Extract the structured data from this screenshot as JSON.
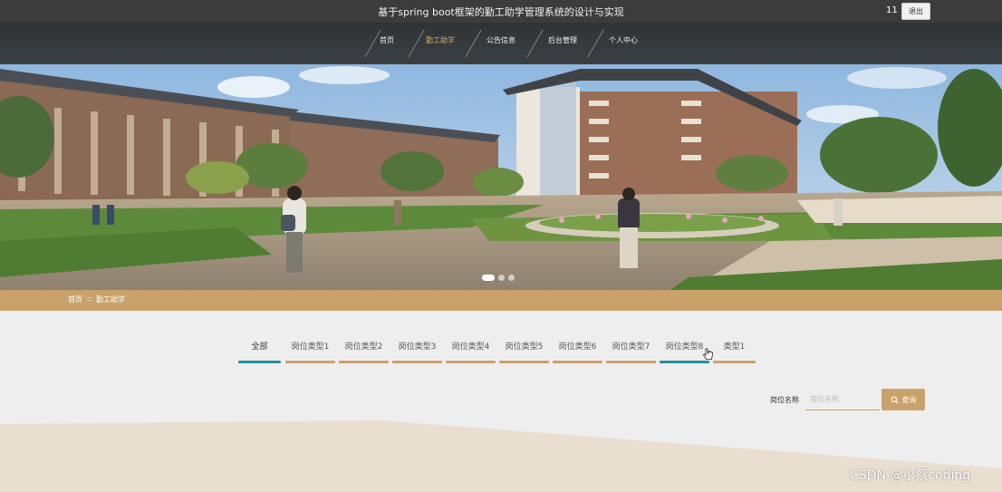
{
  "header": {
    "title": "基于spring boot框架的勤工助学管理系统的设计与实现",
    "user": "11",
    "logout_label": "退出"
  },
  "nav": {
    "items": [
      {
        "label": "首页"
      },
      {
        "label": "勤工助学"
      },
      {
        "label": "公告信息"
      },
      {
        "label": "后台管理"
      },
      {
        "label": "个人中心"
      }
    ],
    "active_index": 1
  },
  "banner": {
    "slide_count": 3,
    "active_slide": 0
  },
  "breadcrumb": {
    "home": "首页",
    "separator": "::",
    "current": "勤工助学"
  },
  "tabs": {
    "items": [
      "全部",
      "岗位类型1",
      "岗位类型2",
      "岗位类型3",
      "岗位类型4",
      "岗位类型5",
      "岗位类型6",
      "岗位类型7",
      "岗位类型8",
      "类型1"
    ],
    "active_index": 0,
    "hover_index": 8
  },
  "search": {
    "label": "岗位名称",
    "placeholder": "岗位名称",
    "value": "",
    "button_label": "查询"
  },
  "watermark": "CSDN @小蔡coding",
  "colors": {
    "accent": "#c9a26b",
    "active_tab": "#2a8d9a",
    "topbar": "#3c3c3c"
  }
}
